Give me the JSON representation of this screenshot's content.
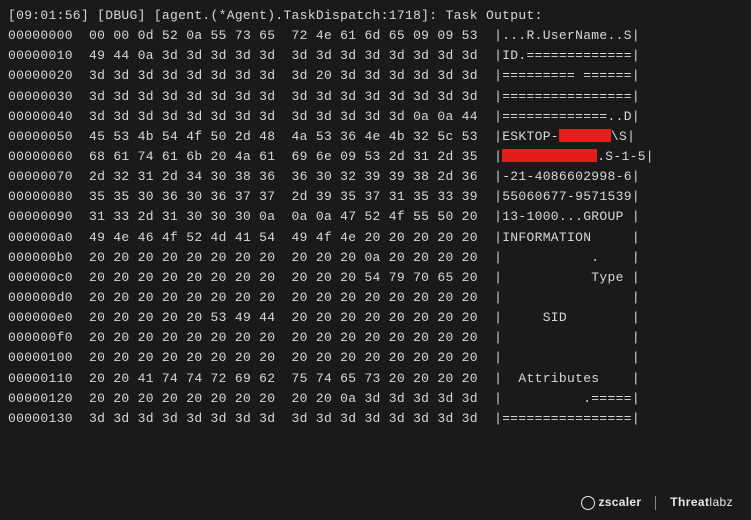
{
  "header": "[09:01:56] [DBUG] [agent.(*Agent).TaskDispatch:1718]: Task Output:",
  "rows": [
    {
      "o": "00000000",
      "h": "00 00 0d 52 0a 55 73 65  72 4e 61 6d 65 09 09 53",
      "a": "|...R.UserName..S|"
    },
    {
      "o": "00000010",
      "h": "49 44 0a 3d 3d 3d 3d 3d  3d 3d 3d 3d 3d 3d 3d 3d",
      "a": "|ID.=============|"
    },
    {
      "o": "00000020",
      "h": "3d 3d 3d 3d 3d 3d 3d 3d  3d 20 3d 3d 3d 3d 3d 3d",
      "a": "|========= ======|"
    },
    {
      "o": "00000030",
      "h": "3d 3d 3d 3d 3d 3d 3d 3d  3d 3d 3d 3d 3d 3d 3d 3d",
      "a": "|================|"
    },
    {
      "o": "00000040",
      "h": "3d 3d 3d 3d 3d 3d 3d 3d  3d 3d 3d 3d 3d 0a 0a 44",
      "a": "|=============..D|"
    },
    {
      "o": "00000050",
      "h": "45 53 4b 54 4f 50 2d 48  4a 53 36 4e 4b 32 5c 53",
      "a": null
    },
    {
      "o": "00000060",
      "h": "68 61 74 61 6b 20 4a 61  69 6e 09 53 2d 31 2d 35",
      "a": null
    },
    {
      "o": "00000070",
      "h": "2d 32 31 2d 34 30 38 36  36 30 32 39 39 38 2d 36",
      "a": "|-21-4086602998-6|"
    },
    {
      "o": "00000080",
      "h": "35 35 30 36 30 36 37 37  2d 39 35 37 31 35 33 39",
      "a": "|55060677-9571539|"
    },
    {
      "o": "00000090",
      "h": "31 33 2d 31 30 30 30 0a  0a 0a 47 52 4f 55 50 20",
      "a": "|13-1000...GROUP |"
    },
    {
      "o": "000000a0",
      "h": "49 4e 46 4f 52 4d 41 54  49 4f 4e 20 20 20 20 20",
      "a": "|INFORMATION     |"
    },
    {
      "o": "000000b0",
      "h": "20 20 20 20 20 20 20 20  20 20 20 0a 20 20 20 20",
      "a": "|           .    |"
    },
    {
      "o": "000000c0",
      "h": "20 20 20 20 20 20 20 20  20 20 20 54 79 70 65 20",
      "a": "|           Type |"
    },
    {
      "o": "000000d0",
      "h": "20 20 20 20 20 20 20 20  20 20 20 20 20 20 20 20",
      "a": "|                |"
    },
    {
      "o": "000000e0",
      "h": "20 20 20 20 20 53 49 44  20 20 20 20 20 20 20 20",
      "a": "|     SID        |"
    },
    {
      "o": "000000f0",
      "h": "20 20 20 20 20 20 20 20  20 20 20 20 20 20 20 20",
      "a": "|                |"
    },
    {
      "o": "00000100",
      "h": "20 20 20 20 20 20 20 20  20 20 20 20 20 20 20 20",
      "a": "|                |"
    },
    {
      "o": "00000110",
      "h": "20 20 41 74 74 72 69 62  75 74 65 73 20 20 20 20",
      "a": "|  Attributes    |"
    },
    {
      "o": "00000120",
      "h": "20 20 20 20 20 20 20 20  20 20 0a 3d 3d 3d 3d 3d",
      "a": "|          .=====|"
    },
    {
      "o": "00000130",
      "h": "3d 3d 3d 3d 3d 3d 3d 3d  3d 3d 3d 3d 3d 3d 3d 3d",
      "a": "|================|"
    }
  ],
  "row5ascii": {
    "pre": "|ESKTOP-",
    "post": "\\S|"
  },
  "row6ascii": {
    "pre": "|",
    "post": ".S-1-5|"
  },
  "footer": {
    "zscaler": "zscaler",
    "threat": "Threat",
    "labz": "labz"
  }
}
